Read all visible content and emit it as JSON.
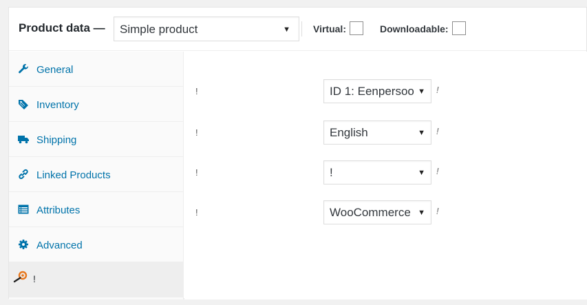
{
  "header": {
    "title": "Product data —",
    "product_type": "Simple product",
    "virtual_label": "Virtual:",
    "downloadable_label": "Downloadable:"
  },
  "tabs": [
    {
      "label": "General",
      "icon": "wrench-icon"
    },
    {
      "label": "Inventory",
      "icon": "tag-icon"
    },
    {
      "label": "Shipping",
      "icon": "truck-icon"
    },
    {
      "label": "Linked Products",
      "icon": "link-icon"
    },
    {
      "label": "Attributes",
      "icon": "list-icon"
    },
    {
      "label": "Advanced",
      "icon": "gear-icon"
    },
    {
      "label": "!",
      "icon": "plugin-magnifier-icon"
    }
  ],
  "fields": [
    {
      "label": "!",
      "value": "ID 1: Eenpersoo",
      "help": "!"
    },
    {
      "label": "!",
      "value": "English",
      "help": "!"
    },
    {
      "label": "!",
      "value": "!",
      "help": "!"
    },
    {
      "label": "!",
      "value": "WooCommerce",
      "help": "!"
    }
  ],
  "colors": {
    "link": "#0073aa",
    "text": "#23282d",
    "border": "#dddddd"
  }
}
